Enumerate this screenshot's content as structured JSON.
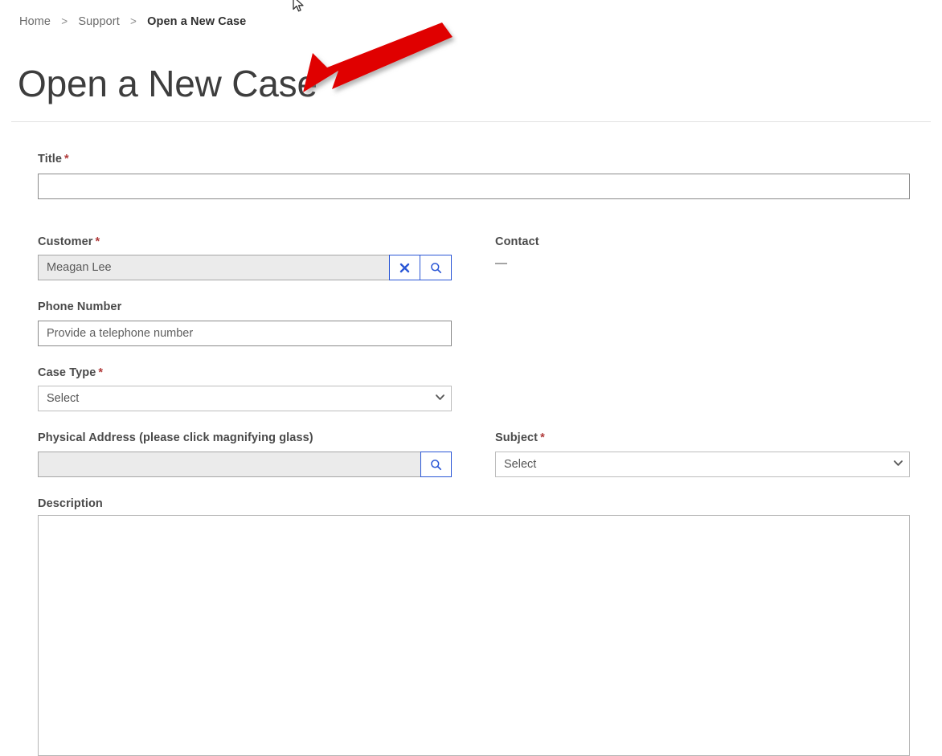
{
  "breadcrumb": {
    "items": [
      {
        "label": "Home",
        "current": false
      },
      {
        "label": "Support",
        "current": false
      },
      {
        "label": "Open a New Case",
        "current": true
      }
    ],
    "separator": ">"
  },
  "page": {
    "title": "Open a New Case"
  },
  "form": {
    "title_field": {
      "label": "Title",
      "required_marker": "*",
      "value": "",
      "placeholder": ""
    },
    "customer_field": {
      "label": "Customer",
      "required_marker": "*",
      "value": "Meagan Lee",
      "placeholder": "",
      "clear_icon": "clear-x-icon",
      "search_icon": "magnifying-glass-icon"
    },
    "contact_field": {
      "label": "Contact",
      "value": "—"
    },
    "phone_field": {
      "label": "Phone Number",
      "value": "",
      "placeholder": "Provide a telephone number"
    },
    "case_type_field": {
      "label": "Case Type",
      "required_marker": "*",
      "selected": "Select",
      "options": [
        "Select"
      ],
      "chevron_icon": "chevron-down-icon"
    },
    "address_field": {
      "label": "Physical Address (please click magnifying glass)",
      "value": "",
      "placeholder": "",
      "search_icon": "magnifying-glass-icon"
    },
    "subject_field": {
      "label": "Subject",
      "required_marker": "*",
      "selected": "Select",
      "options": [
        "Select"
      ],
      "chevron_icon": "chevron-down-icon"
    },
    "description_field": {
      "label": "Description",
      "value": "",
      "placeholder": ""
    }
  },
  "annotations": {
    "arrow": {
      "name": "red-annotation-arrow",
      "color": "#e00000",
      "points_to": "Open a New Case"
    },
    "cursor": {
      "name": "mouse-cursor"
    }
  },
  "colors": {
    "accent_blue": "#2b57d6",
    "required_red": "#b03a3a",
    "annotation_red": "#e00000",
    "label_gray": "#4a4a4a",
    "readonly_bg": "#ebebeb"
  }
}
